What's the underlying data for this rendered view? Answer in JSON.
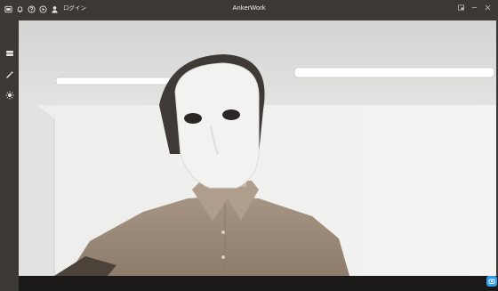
{
  "window": {
    "title": "AnkerWork"
  },
  "toolbar": {
    "login_label": "ログイン",
    "icons": [
      "screen-icon",
      "notification-icon",
      "help-icon",
      "play-icon",
      "user-icon"
    ]
  },
  "sidebar": {
    "items": [
      {
        "icon": "camera-device-icon"
      },
      {
        "icon": "magic-wand-icon"
      },
      {
        "icon": "light-icon"
      }
    ]
  },
  "video": {
    "description_colors": {
      "wall": "#e7e7e6",
      "shirt": "#a18f7f",
      "mask": "#f2f2f0"
    }
  },
  "colors": {
    "chrome": "#3b3835",
    "accent": "#2f9ee8"
  }
}
